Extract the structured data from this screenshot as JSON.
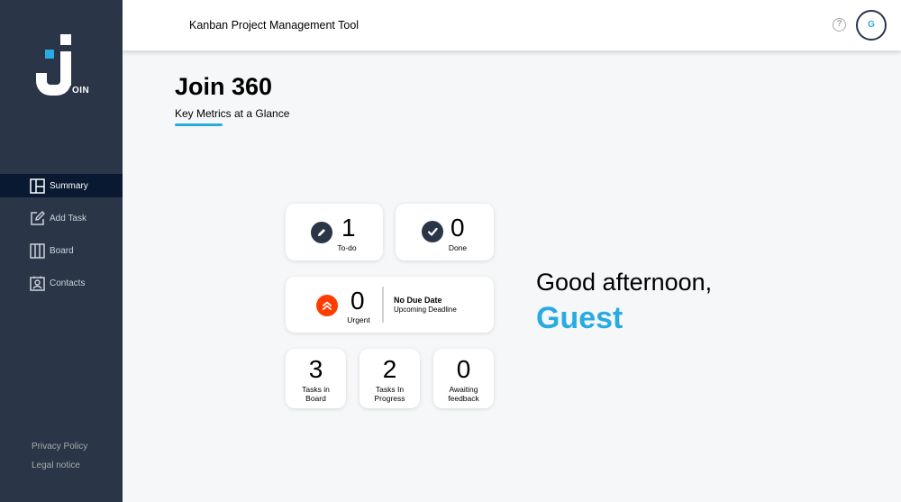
{
  "sidebar": {
    "logo_text": "OIN",
    "items": [
      {
        "label": "Summary",
        "icon": "summary-icon",
        "active": true
      },
      {
        "label": "Add Task",
        "icon": "add-task-icon",
        "active": false
      },
      {
        "label": "Board",
        "icon": "board-icon",
        "active": false
      },
      {
        "label": "Contacts",
        "icon": "contacts-icon",
        "active": false
      }
    ],
    "footer": {
      "privacy": "Privacy Policy",
      "legal": "Legal notice"
    }
  },
  "header": {
    "title": "Kanban Project Management Tool",
    "help_glyph": "?",
    "avatar_initial": "G"
  },
  "main": {
    "title": "Join 360",
    "subtitle": "Key Metrics at a Glance"
  },
  "metrics": {
    "todo": {
      "count": "1",
      "label": "To-do",
      "icon": "pencil-icon"
    },
    "done": {
      "count": "0",
      "label": "Done",
      "icon": "check-icon"
    },
    "urgent": {
      "count": "0",
      "label": "Urgent",
      "icon": "urgent-chevrons-icon",
      "deadline_title": "No Due Date",
      "deadline_label": "Upcoming Deadline"
    },
    "board": {
      "count": "3",
      "label_line1": "Tasks in",
      "label_line2": "Board"
    },
    "progress": {
      "count": "2",
      "label_line1": "Tasks In",
      "label_line2": "Progress"
    },
    "feedback": {
      "count": "0",
      "label_line1": "Awaiting",
      "label_line2": "feedback"
    }
  },
  "greeting": {
    "text": "Good afternoon,",
    "name": "Guest"
  },
  "colors": {
    "sidebar": "#2a3647",
    "sidebar_active": "#091931",
    "accent": "#29abe2",
    "urgent": "#ff3d00",
    "icon_dark": "#2a3647"
  }
}
